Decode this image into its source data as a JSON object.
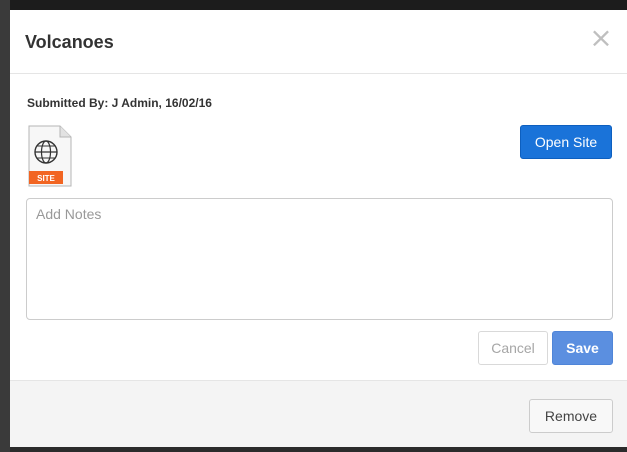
{
  "modal": {
    "title": "Volcanoes",
    "close_symbol": "×"
  },
  "submission": {
    "text": "Submitted By: J Admin, 16/02/16"
  },
  "file_icon": {
    "icon": "globe-icon",
    "label": "SITE",
    "label_color": "#f26522"
  },
  "actions": {
    "open_site_label": "Open Site",
    "cancel_label": "Cancel",
    "save_label": "Save",
    "remove_label": "Remove"
  },
  "notes": {
    "placeholder": "Add Notes",
    "value": ""
  },
  "colors": {
    "primary": "#1a73d9",
    "save": "#5b8fe0"
  }
}
